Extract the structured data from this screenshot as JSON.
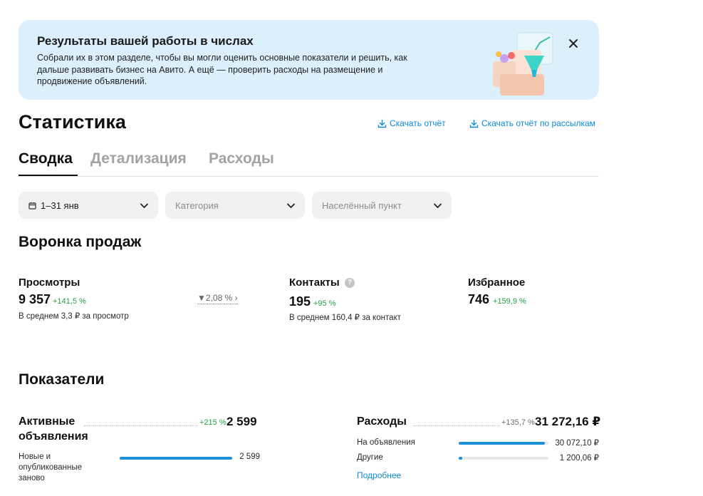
{
  "banner": {
    "title": "Результаты вашей работы в числах",
    "text": "Собрали их в этом разделе, чтобы вы могли оценить основные показатели и решить, как дальше развивать бизнес на Авито. А ещё — проверить расходы на размещение и продвижение объявлений.",
    "close_icon": "close-icon",
    "illustration": "funnel-chart-illustration"
  },
  "header": {
    "title": "Статистика",
    "download_report": "Скачать отчёт",
    "download_mailing_report": "Скачать отчёт по рассылкам",
    "download_icon": "download-icon"
  },
  "tabs": [
    {
      "label": "Сводка",
      "active": true
    },
    {
      "label": "Детализация",
      "active": false
    },
    {
      "label": "Расходы",
      "active": false
    }
  ],
  "filters": {
    "period": {
      "value": "1–31 янв",
      "icon": "calendar-icon"
    },
    "category": {
      "placeholder": "Категория"
    },
    "city": {
      "placeholder": "Населённый пункт"
    },
    "chevron_icon": "chevron-down-icon"
  },
  "funnel": {
    "title": "Воронка продаж",
    "views": {
      "label": "Просмотры",
      "value": "9 357",
      "delta": "+141,5 %",
      "sub": "В среднем 3,3 ₽ за просмотр"
    },
    "conversion": "2,08 %",
    "contacts": {
      "label": "Контакты",
      "help": "?",
      "value": "195",
      "delta": "+95 %",
      "sub": "В среднем 160,4 ₽ за контакт"
    },
    "favorites": {
      "label": "Избранное",
      "value": "746",
      "delta": "+159,9 %"
    }
  },
  "indicators": {
    "title": "Показатели",
    "active_ads": {
      "label": "Активные объявления",
      "delta": "+215 %",
      "value": "2 599",
      "rows": [
        {
          "label": "Новые и опубликованные заново",
          "value": "2 599",
          "fraction": 1.0
        }
      ]
    },
    "expenses": {
      "label": "Расходы",
      "delta": "+135,7 %",
      "value": "31 272,16 ₽",
      "rows": [
        {
          "label": "На объявления",
          "value": "30 072,10 ₽",
          "fraction": 0.962
        },
        {
          "label": "Другие",
          "value": "1 200,06 ₽",
          "fraction": 0.038
        }
      ],
      "more": "Подробнее"
    }
  },
  "colors": {
    "accent": "#0a8ad8",
    "positive": "#26a145",
    "bar": "#1c8fd9",
    "banner_bg": "#dbeffc"
  }
}
